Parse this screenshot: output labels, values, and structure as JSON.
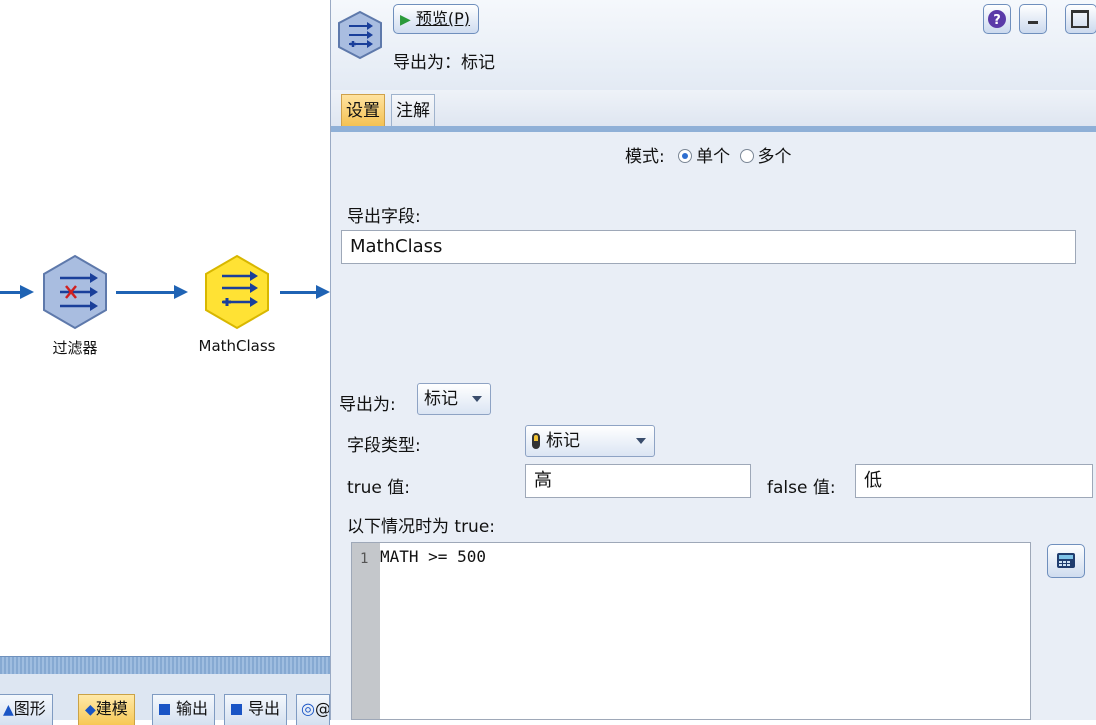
{
  "canvas": {
    "nodes": [
      {
        "label": "过滤器"
      },
      {
        "label": "MathClass"
      }
    ]
  },
  "palette": {
    "tabs": [
      {
        "label": "图形",
        "icon": "triangle-icon"
      },
      {
        "label": "建模",
        "icon": "diamond-icon",
        "active": true
      },
      {
        "label": "输出",
        "icon": "square-icon"
      },
      {
        "label": "导出",
        "icon": "square-icon"
      },
      {
        "label": "@II",
        "icon": "search-icon"
      }
    ]
  },
  "dialog": {
    "preview_label": "预览(P)",
    "node_title": "导出为：标记",
    "tabs": [
      "设置",
      "注解"
    ],
    "active_tab": "设置",
    "mode": {
      "label": "模式:",
      "options": [
        "单个",
        "多个"
      ],
      "selected": "单个"
    },
    "derive_field_label": "导出字段:",
    "derive_field_value": "MathClass",
    "derive_as_label": "导出为:",
    "derive_as_value": "标记",
    "field_type_label": "字段类型:",
    "field_type_value": "标记",
    "true_label": "true 值:",
    "true_value": "高",
    "false_label": "false 值:",
    "false_value": "低",
    "condition_label": "以下情况时为 true:",
    "expression_line_number": "1",
    "expression": "MATH >= 500"
  },
  "colors": {
    "flow_blue": "#1f63b4",
    "active_tab": "#f3bf4e",
    "node_blue": "#9fb5db",
    "node_yellow": "#ffe234"
  }
}
